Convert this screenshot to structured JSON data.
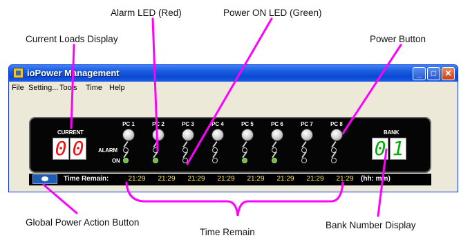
{
  "annotations": {
    "alarm_led": "Alarm LED (Red)",
    "power_on_led": "Power ON LED (Green)",
    "current_loads": "Current Loads Display",
    "power_button": "Power Button",
    "global_power": "Global Power Action Button",
    "time_remain": "Time Remain",
    "bank_number": "Bank Number Display"
  },
  "window": {
    "title": "ioPower Management",
    "minimize": "_",
    "maximize": "□",
    "close": "✕"
  },
  "menu": [
    "File",
    "Setting...",
    "Tools",
    "Time",
    "Help"
  ],
  "panel": {
    "current_label": "CURRENT",
    "current_digits": [
      "0",
      "0"
    ],
    "alarm_label": "ALARM",
    "on_label": "ON",
    "bank_label": "BANK",
    "bank_digits": [
      "0",
      "1"
    ],
    "pcs": [
      {
        "label": "PC 1",
        "led_on": true
      },
      {
        "label": "PC 2",
        "led_on": true
      },
      {
        "label": "PC 3",
        "led_on": false
      },
      {
        "label": "PC 4",
        "led_on": false
      },
      {
        "label": "PC 5",
        "led_on": true
      },
      {
        "label": "PC 6",
        "led_on": true
      },
      {
        "label": "PC 7",
        "led_on": false
      },
      {
        "label": "PC 8",
        "led_on": false
      }
    ]
  },
  "time_bar": {
    "label": "Time Remain:",
    "times": [
      "21:29",
      "21:29",
      "21:29",
      "21:29",
      "21:29",
      "21:29",
      "21:29",
      "21:29"
    ],
    "unit": "(hh: mm)"
  },
  "colors": {
    "callout_line": "#ff00ff",
    "titlebar": "#0a48d1",
    "panel_bg": "#050505",
    "current_digit": "#ee1111",
    "bank_digit": "#00b000",
    "time_text": "#ffeb66",
    "led_on": "#6fbf3a"
  },
  "icons": {
    "app": "app-icon",
    "global_power": "power-action-icon"
  }
}
